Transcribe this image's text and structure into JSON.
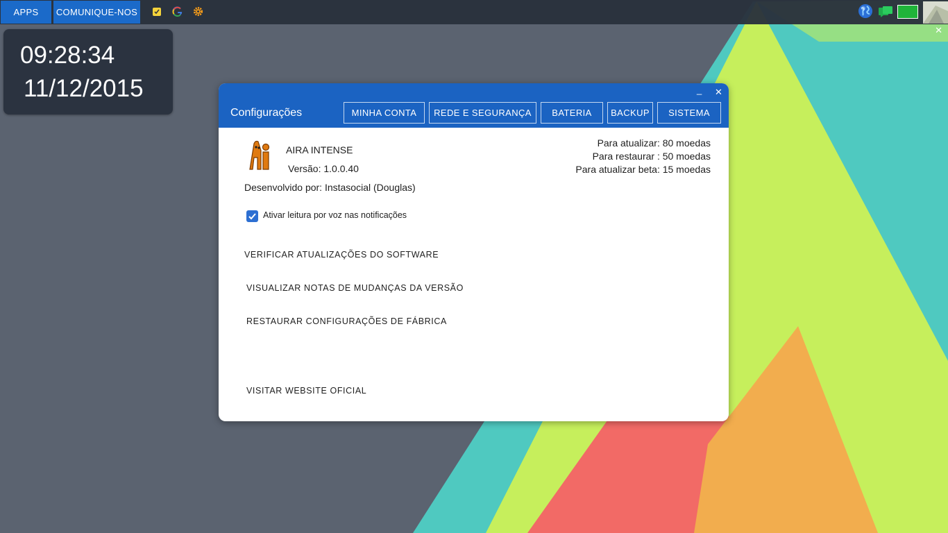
{
  "taskbar": {
    "apps_label": "APPS",
    "contact_label": "COMUNIQUE-NOS",
    "icons": [
      "notes-icon",
      "google-icon",
      "gear-icon"
    ],
    "tray_icons": [
      "globe-icon",
      "chat-icon",
      "battery-icon",
      "avatar"
    ],
    "close_label": "✕"
  },
  "clock": {
    "time": "09:28:34",
    "date": "11/12/2015"
  },
  "window": {
    "title": "Configurações",
    "minimize_label": "_",
    "close_label": "✕",
    "tabs": [
      {
        "label": "MINHA CONTA"
      },
      {
        "label": "REDE E SEGURANÇA"
      },
      {
        "label": "BATERIA"
      },
      {
        "label": "BACKUP"
      },
      {
        "label": "SISTEMA"
      }
    ],
    "app": {
      "name": "AIRA INTENSE",
      "version": "Versão: 1.0.0.40",
      "developer": "Desenvolvido por: Instasocial (Douglas)"
    },
    "prices": {
      "update": "Para atualizar: 80 moedas",
      "restore": "Para restaurar : 50 moedas",
      "beta": "Para atualizar beta: 15 moedas"
    },
    "voice_option": {
      "label": "Ativar leitura por voz nas notificações",
      "checked": true
    },
    "actions": {
      "check_updates": "VERIFICAR ATUALIZAÇÕES DO SOFTWARE",
      "view_notes": "VISUALIZAR NOTAS DE MUDANÇAS DA VERSÃO",
      "restore_factory": "RESTAURAR CONFIGURAÇÕES DE FÁBRICA",
      "visit_website": "VISITAR WEBSITE OFICIAL"
    }
  },
  "colors": {
    "accent": "#1b63c2",
    "taskbar": "#2a313c",
    "desktop": "#5b6370",
    "wallpaper": [
      "#4fc9c0",
      "#c6ef5c",
      "#f26a66",
      "#f2ad4e"
    ]
  }
}
